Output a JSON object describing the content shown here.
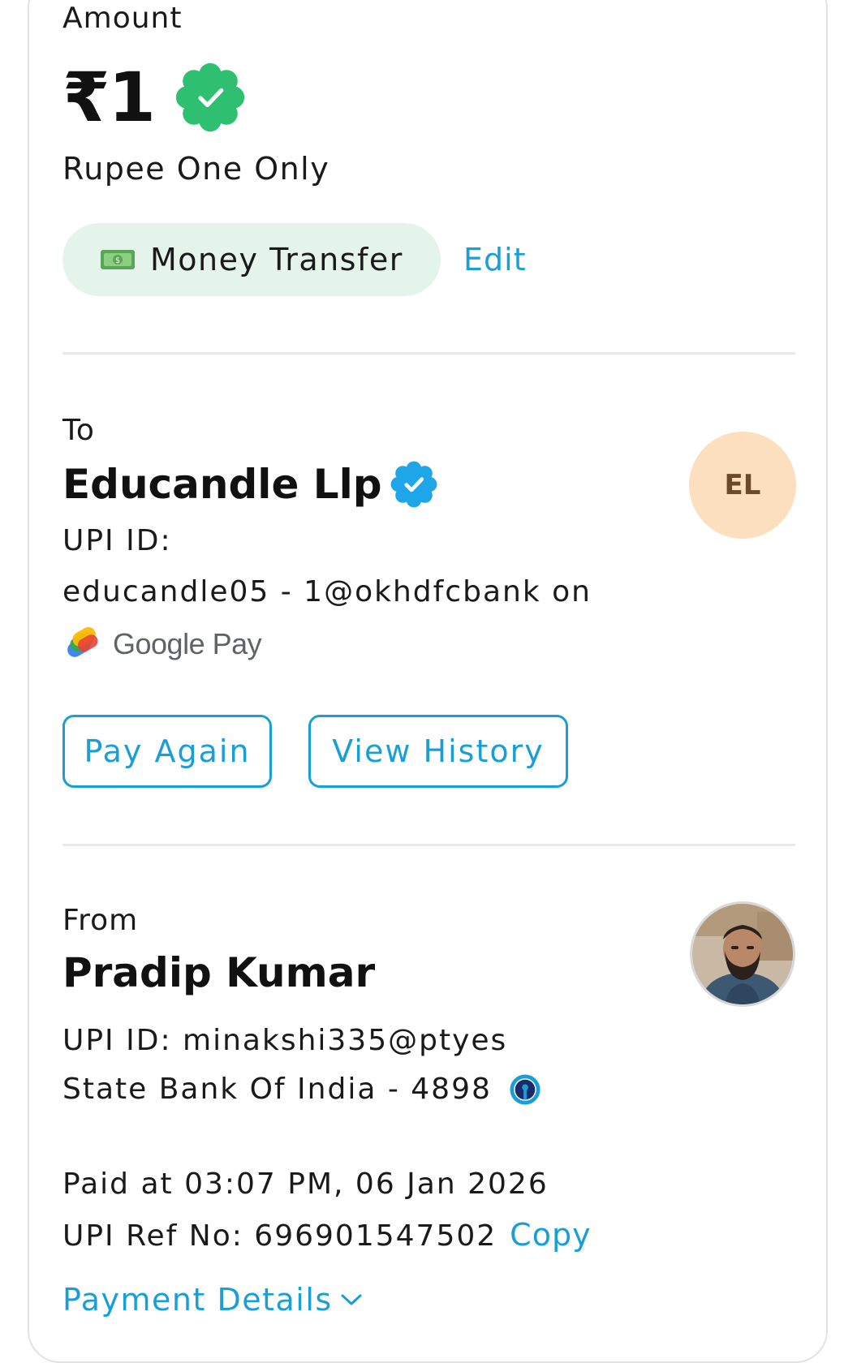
{
  "amount": {
    "label": "Amount",
    "value": "₹1",
    "words": "Rupee One Only",
    "verified_icon": "verified-check-green-icon"
  },
  "category": {
    "emoji_icon": "money-bill-emoji-icon",
    "label": "Money Transfer",
    "edit_label": "Edit"
  },
  "to": {
    "label": "To",
    "name": "Educandle Llp",
    "verified_icon": "verified-check-blue-icon",
    "avatar_initials": "EL",
    "upi_label": "UPI ID:",
    "upi_line": "educandle05 - 1@okhdfcbank on",
    "app_logo_text": "Google Pay"
  },
  "actions": {
    "pay_again": "Pay Again",
    "view_history": "View History"
  },
  "from": {
    "label": "From",
    "name": "Pradip Kumar",
    "upi_line": "UPI ID: minakshi335@ptyes",
    "bank_line": "State Bank Of India - 4898",
    "bank_icon": "sbi-logo-icon"
  },
  "transaction": {
    "paid_at": "Paid at 03:07 PM, 06 Jan 2026",
    "ref_line": "UPI Ref No: 696901547502",
    "copy_label": "Copy",
    "details_label": "Payment Details"
  },
  "colors": {
    "accent": "#1a9ed8",
    "verified_green": "#2fbf71",
    "verified_blue": "#1fa6e8",
    "pill_bg": "#e4f4ea",
    "avatar_bg": "#fbdfbf"
  }
}
